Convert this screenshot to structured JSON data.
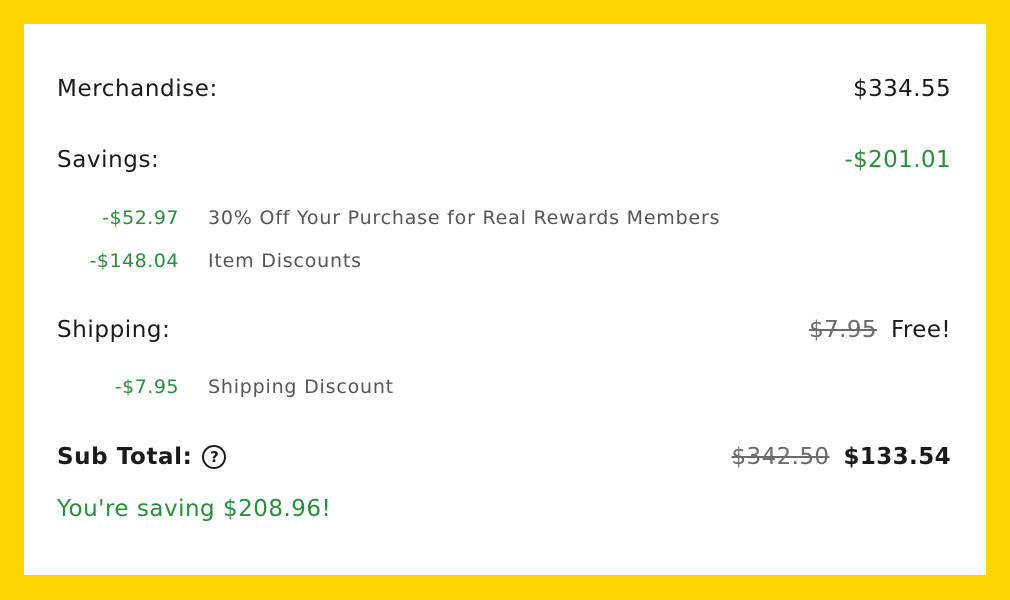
{
  "colors": {
    "frame": "#FFD600",
    "card": "#FFFFFF",
    "savings_green": "#2E8B3E",
    "text": "#1A1A1A"
  },
  "merchandise": {
    "label": "Merchandise:",
    "amount": "$334.55"
  },
  "savings": {
    "label": "Savings:",
    "amount": "-$201.01",
    "items": [
      {
        "amount": "-$52.97",
        "description": "30% Off Your Purchase for Real Rewards Members"
      },
      {
        "amount": "-$148.04",
        "description": "Item Discounts"
      }
    ]
  },
  "shipping": {
    "label": "Shipping:",
    "original": "$7.95",
    "value": "Free!",
    "items": [
      {
        "amount": "-$7.95",
        "description": "Shipping Discount"
      }
    ]
  },
  "subtotal": {
    "label": "Sub Total:",
    "help_glyph": "?",
    "original": "$342.50",
    "amount": "$133.54"
  },
  "savings_message": "You're saving $208.96!"
}
